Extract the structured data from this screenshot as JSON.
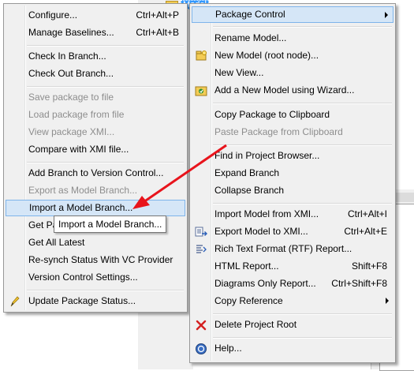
{
  "background": {
    "tree_node_label": "Model"
  },
  "left_menu": {
    "items": [
      {
        "label": "Configure...",
        "shortcut": "Ctrl+Alt+P",
        "disabled": false
      },
      {
        "label": "Manage Baselines...",
        "shortcut": "Ctrl+Alt+B",
        "disabled": false
      },
      {
        "label": "Check In Branch...",
        "disabled": false
      },
      {
        "label": "Check Out Branch...",
        "disabled": false
      },
      {
        "label": "Save package to file",
        "disabled": true
      },
      {
        "label": "Load package from file",
        "disabled": true
      },
      {
        "label": "View package XMI...",
        "disabled": true
      },
      {
        "label": "Compare with XMI file...",
        "disabled": false
      },
      {
        "label": "Add Branch to Version Control...",
        "disabled": false
      },
      {
        "label": "Export as Model Branch...",
        "disabled": true
      },
      {
        "label": "Import a Model Branch...",
        "disabled": false,
        "highlighted": true
      },
      {
        "label": "Get Pa",
        "disabled": false
      },
      {
        "label": "Get All Latest",
        "disabled": false
      },
      {
        "label": "Re-synch Status With VC Provider",
        "disabled": false
      },
      {
        "label": "Version Control Settings...",
        "disabled": false
      },
      {
        "label": "Update Package Status...",
        "disabled": false,
        "icon": "pencil-icon"
      }
    ]
  },
  "tooltip": {
    "text": "Import a Model Branch..."
  },
  "right_menu": {
    "items": [
      {
        "label": "Package Control",
        "submenu": true,
        "highlighted": true
      },
      {
        "label": "Rename Model..."
      },
      {
        "label": "New Model (root node)...",
        "icon": "new-model-icon"
      },
      {
        "label": "New View..."
      },
      {
        "label": "Add a New Model using Wizard...",
        "icon": "wizard-icon"
      },
      {
        "label": "Copy Package to Clipboard"
      },
      {
        "label": "Paste Package from Clipboard",
        "disabled": true
      },
      {
        "label": "Find in Project Browser..."
      },
      {
        "label": "Expand Branch"
      },
      {
        "label": "Collapse Branch"
      },
      {
        "label": "Import Model from XMI...",
        "shortcut": "Ctrl+Alt+I"
      },
      {
        "label": "Export Model to XMI...",
        "shortcut": "Ctrl+Alt+E",
        "icon": "xmi-export-icon"
      },
      {
        "label": "Rich Text Format (RTF) Report...",
        "icon": "rtf-report-icon"
      },
      {
        "label": "HTML Report...",
        "shortcut": "Shift+F8"
      },
      {
        "label": "Diagrams Only Report...",
        "shortcut": "Ctrl+Shift+F8"
      },
      {
        "label": "Copy Reference",
        "submenu": true
      },
      {
        "label": "Delete Project Root",
        "icon": "delete-x-icon"
      },
      {
        "label": "Help...",
        "icon": "help-icon"
      }
    ]
  },
  "colors": {
    "menu_bg": "#f0f0f0",
    "highlight_bg": "#d5e6f7",
    "highlight_border": "#7eb4ea",
    "disabled_text": "#8d8d8d",
    "annotation_arrow": "#e8141c"
  }
}
